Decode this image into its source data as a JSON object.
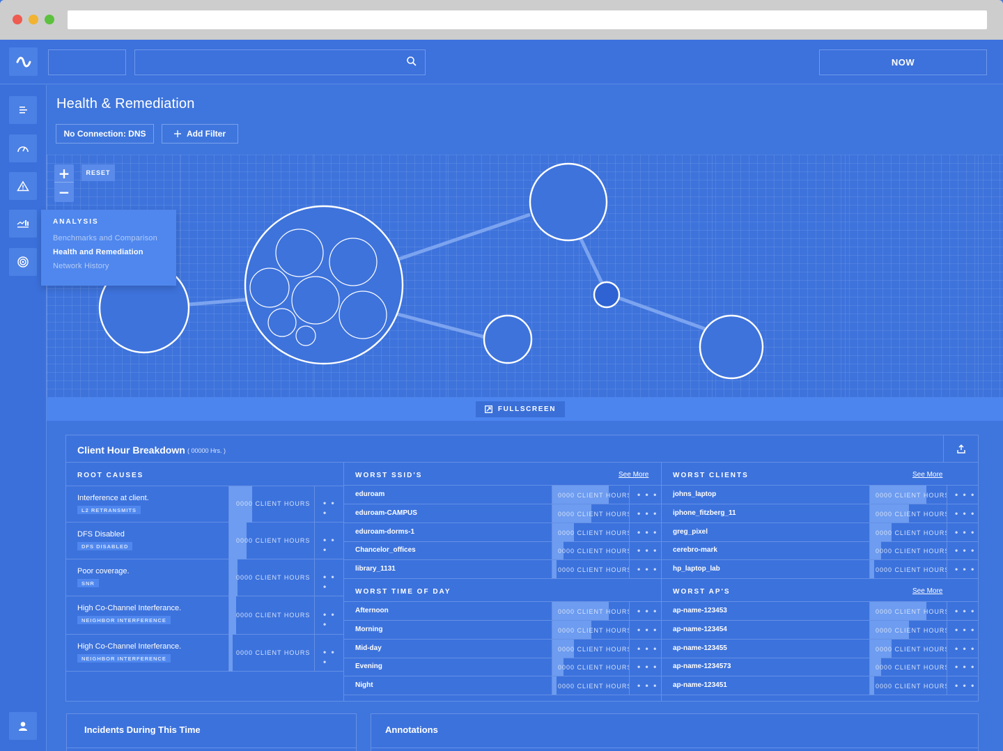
{
  "app": {
    "now_label": "NOW",
    "page_title": "Health & Remediation"
  },
  "sidebar": {
    "items": [
      "menu-icon",
      "speedometer-icon",
      "warning-icon",
      "analysis-icon",
      "target-icon"
    ],
    "user": "user-icon"
  },
  "filters": {
    "chip": "No Connection: DNS",
    "add_label": "Add Filter"
  },
  "graph": {
    "reset_label": "RESET",
    "zoom_in": "+",
    "zoom_out": "−",
    "fullscreen_label": "FULLSCREEN"
  },
  "menu": {
    "title": "ANALYSIS",
    "items": [
      "Benchmarks and Comparison",
      "Health and Remediation",
      "Network History"
    ],
    "active": "Health and Remediation"
  },
  "breakdown": {
    "title": "Client Hour Breakdown",
    "subtitle": "( 00000 Hrs. )",
    "root_causes": {
      "header": "ROOT CAUSES",
      "rows": [
        {
          "label": "Interference at client.",
          "tag": "L2 RETRANSMITS",
          "value": "0000 CLIENT HOURS",
          "fill": 0.27
        },
        {
          "label": "DFS Disabled",
          "tag": "DFS DISABLED",
          "value": "0000 CLIENT HOURS",
          "fill": 0.2
        },
        {
          "label": "Poor coverage.",
          "tag": "SNR",
          "value": "0000 CLIENT HOURS",
          "fill": 0.1
        },
        {
          "label": "High Co-Channel Interferance.",
          "tag": "NEIGHBOR INTERFERENCE",
          "value": "0000 CLIENT HOURS",
          "fill": 0.08
        },
        {
          "label": "High Co-Channel Interferance.",
          "tag": "NEIGHBOR INTERFERENCE",
          "value": "0000 CLIENT HOURS",
          "fill": 0.04
        }
      ]
    },
    "worst_ssids": {
      "header": "WORST SSID'S",
      "see_more": "See More",
      "rows": [
        {
          "label": "eduroam",
          "value": "0000 CLIENT HOURS",
          "fill": 0.72
        },
        {
          "label": "eduroam-CAMPUS",
          "value": "0000 CLIENT HOURS",
          "fill": 0.5
        },
        {
          "label": "eduroam-dorms-1",
          "value": "0000 CLIENT HOURS",
          "fill": 0.28
        },
        {
          "label": "Chancelor_offices",
          "value": "0000 CLIENT HOURS",
          "fill": 0.14
        },
        {
          "label": "library_1131",
          "value": "0000 CLIENT HOURS",
          "fill": 0.05
        }
      ]
    },
    "worst_clients": {
      "header": "WORST CLIENTS",
      "see_more": "See More",
      "rows": [
        {
          "label": "johns_laptop",
          "value": "0000 CLIENT HOURS",
          "fill": 0.72
        },
        {
          "label": "iphone_fitzberg_11",
          "value": "0000 CLIENT HOURS",
          "fill": 0.5
        },
        {
          "label": "greg_pixel",
          "value": "0000 CLIENT HOURS",
          "fill": 0.28
        },
        {
          "label": "cerebro-mark",
          "value": "0000 CLIENT HOURS",
          "fill": 0.14
        },
        {
          "label": "hp_laptop_lab",
          "value": "0000 CLIENT HOURS",
          "fill": 0.05
        }
      ]
    },
    "worst_time": {
      "header": "WORST TIME OF DAY",
      "rows": [
        {
          "label": "Afternoon",
          "value": "0000 CLIENT HOURS",
          "fill": 0.72
        },
        {
          "label": "Morning",
          "value": "0000 CLIENT HOURS",
          "fill": 0.5
        },
        {
          "label": "Mid-day",
          "value": "0000 CLIENT HOURS",
          "fill": 0.28
        },
        {
          "label": "Evening",
          "value": "0000 CLIENT HOURS",
          "fill": 0.14
        },
        {
          "label": "Night",
          "value": "0000 CLIENT HOURS",
          "fill": 0.05
        }
      ]
    },
    "worst_aps": {
      "header": "WORST AP'S",
      "see_more": "See More",
      "rows": [
        {
          "label": "ap-name-123453",
          "value": "0000 CLIENT HOURS",
          "fill": 0.72
        },
        {
          "label": "ap-name-123454",
          "value": "0000 CLIENT HOURS",
          "fill": 0.5
        },
        {
          "label": "ap-name-123455",
          "value": "0000 CLIENT HOURS",
          "fill": 0.28
        },
        {
          "label": "ap-name-1234573",
          "value": "0000 CLIENT HOURS",
          "fill": 0.14
        },
        {
          "label": "ap-name-123451",
          "value": "0000 CLIENT HOURS",
          "fill": 0.05
        }
      ]
    },
    "more_label": "• • •"
  },
  "cards": {
    "incidents_title": "Incidents During This Time",
    "annotations_title": "Annotations"
  },
  "colors": {
    "background": "#3f76dd",
    "panel": "#3c72dc",
    "bar_fill": "#6d9cf0",
    "menu_bg": "#4f87ee"
  }
}
